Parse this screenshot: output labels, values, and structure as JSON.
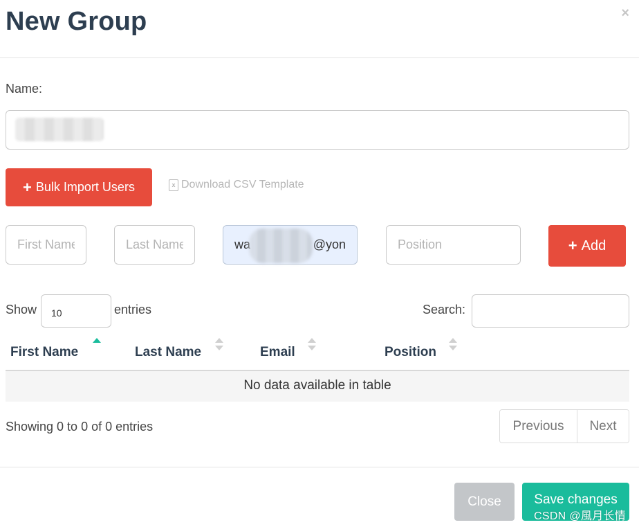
{
  "modal": {
    "title": "New Group",
    "close_icon": "×"
  },
  "form": {
    "name_label": "Name:",
    "name_value": "",
    "bulk_import_label": "Bulk Import Users",
    "csv_template_label": "Download CSV Template",
    "plus_glyph": "+",
    "first_name_placeholder": "First Name",
    "last_name_placeholder": "Last Name",
    "email_prefix": "wa",
    "email_suffix": "@yon",
    "position_placeholder": "Position",
    "add_label": "Add"
  },
  "table_controls": {
    "show_label": "Show",
    "page_size": "10",
    "entries_label": "entries",
    "search_label": "Search:",
    "search_value": ""
  },
  "table": {
    "columns": [
      "First Name",
      "Last Name",
      "Email",
      "Position"
    ],
    "sorted_column": "First Name",
    "sort_direction": "asc",
    "empty_message": "No data available in table"
  },
  "pagination": {
    "info": "Showing 0 to 0 of 0 entries",
    "previous_label": "Previous",
    "next_label": "Next"
  },
  "footer": {
    "close_label": "Close",
    "save_label": "Save changes"
  },
  "watermark": "CSDN @風月长情",
  "colors": {
    "danger": "#e74c3c",
    "success": "#1abc9c",
    "secondary": "#c3c6c9",
    "title": "#2d3e50"
  },
  "icons": {
    "close": "close-icon",
    "plus": "plus-icon",
    "excel_file": "file-excel-icon",
    "sort": "sort-icon"
  }
}
